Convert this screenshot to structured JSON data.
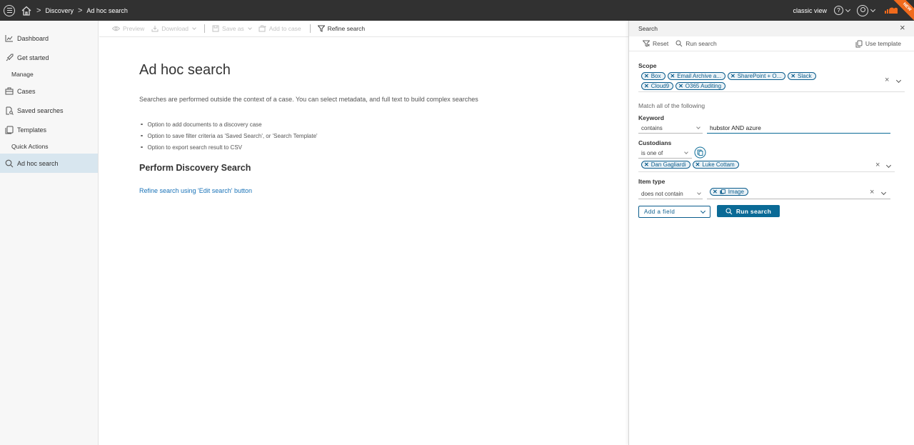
{
  "header": {
    "breadcrumbs": [
      "Discovery",
      "Ad hoc search"
    ],
    "classic_view": "classic view",
    "badge": "NEW"
  },
  "sidebar": {
    "items": [
      {
        "label": "Dashboard",
        "icon": "dashboard-icon"
      },
      {
        "label": "Get started",
        "icon": "rocket-icon"
      },
      {
        "label": "Manage",
        "type": "section"
      },
      {
        "label": "Cases",
        "icon": "briefcase-icon"
      },
      {
        "label": "Saved searches",
        "icon": "saved-search-icon"
      },
      {
        "label": "Templates",
        "icon": "template-icon"
      },
      {
        "label": "Quick Actions",
        "type": "section"
      },
      {
        "label": "Ad hoc search",
        "icon": "search-icon",
        "active": true
      }
    ]
  },
  "toolbar": {
    "preview": "Preview",
    "download": "Download",
    "save_as": "Save as",
    "add_to_case": "Add to case",
    "refine_search": "Refine search"
  },
  "main": {
    "title": "Ad hoc search",
    "intro": "Searches are performed outside the context of a case. You can select metadata, and full text to build complex searches",
    "bullets": [
      "Option to add documents to a discovery case",
      "Option to save filter criteria as 'Saved Search', or 'Search Template'",
      "Option to export search result to CSV"
    ],
    "subtitle": "Perform Discovery Search",
    "refine_link": "Refine search using 'Edit search' button"
  },
  "panel": {
    "title": "Search",
    "reset": "Reset",
    "run_search_tool": "Run search",
    "use_template": "Use template",
    "scope": {
      "label": "Scope",
      "chips": [
        "Box",
        "Email Archive a...",
        "SharePoint + O...",
        "Slack",
        "Cloud9",
        "O365 Auditing"
      ]
    },
    "match_text": "Match all of the following",
    "keyword": {
      "label": "Keyword",
      "operator": "contains",
      "value": "hubstor AND azure"
    },
    "custodians": {
      "label": "Custodians",
      "operator": "is one of",
      "chips": [
        "Dan Gagliardi",
        "Luke Cottam"
      ]
    },
    "item_type": {
      "label": "Item type",
      "operator": "does not contain",
      "chips": [
        "Image"
      ]
    },
    "add_field": "Add a field",
    "run_button": "Run search"
  },
  "colors": {
    "accent": "#0a6a96",
    "topbar": "#313131",
    "badge": "#f06a1c"
  }
}
